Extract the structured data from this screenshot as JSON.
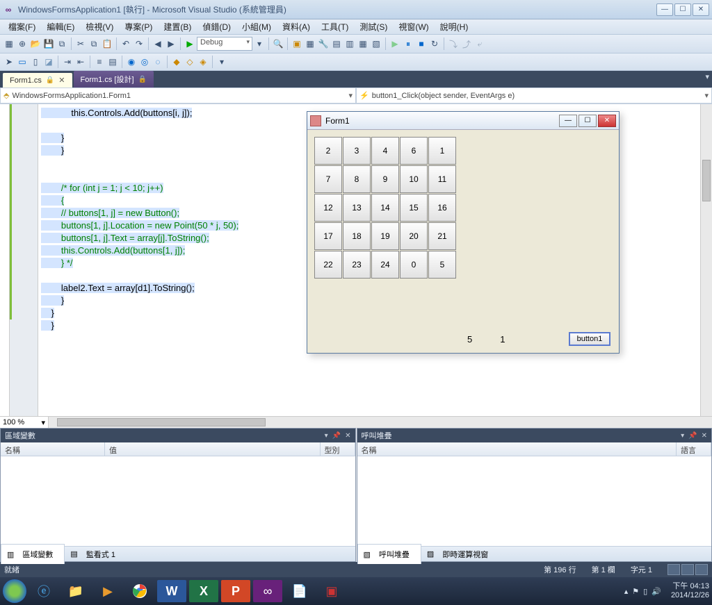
{
  "window": {
    "title": "WindowsFormsApplication1 [執行] - Microsoft Visual Studio (系統管理員)"
  },
  "menu": [
    "檔案(F)",
    "編輯(E)",
    "檢視(V)",
    "專案(P)",
    "建置(B)",
    "偵錯(D)",
    "小組(M)",
    "資料(A)",
    "工具(T)",
    "測試(S)",
    "視窗(W)",
    "說明(H)"
  ],
  "toolbar": {
    "config": "Debug"
  },
  "tabs": [
    {
      "label": "Form1.cs",
      "pinned": true,
      "active": true
    },
    {
      "label": "Form1.cs [設計]",
      "pinned": true,
      "active": false
    }
  ],
  "nav": {
    "left": "WindowsFormsApplication1.Form1",
    "right": "button1_Click(object sender, EventArgs e)"
  },
  "code": {
    "l1": "            this.Controls.Add(buttons[i, j]);",
    "l2": "",
    "l3": "        }",
    "l4": "        }",
    "l5": "",
    "l6": "",
    "l7": "        /* for (int j = 1; j < 10; j++)",
    "l8": "        {",
    "l9": "        // buttons[1, j] = new Button();",
    "l10": "        buttons[1, j].Location = new Point(50 * j, 50);",
    "l11": "        buttons[1, j].Text = array[j].ToString();",
    "l12": "        this.Controls.Add(buttons[1, j]);",
    "l13": "        } */",
    "l14": "",
    "l15": "        label2.Text = array[d1].ToString();",
    "l16": "        }",
    "l17": "    }",
    "l18": "    }",
    "l19": ""
  },
  "zoom": "100 %",
  "runform": {
    "title": "Form1",
    "grid": [
      "2",
      "3",
      "4",
      "6",
      "1",
      "7",
      "8",
      "9",
      "10",
      "11",
      "12",
      "13",
      "14",
      "15",
      "16",
      "17",
      "18",
      "19",
      "20",
      "21",
      "22",
      "23",
      "24",
      "0",
      "5"
    ],
    "label_a": "5",
    "label_b": "1",
    "button": "button1"
  },
  "panels": {
    "left": {
      "title": "區域變數",
      "cols": {
        "name": "名稱",
        "value": "值",
        "type": "型別"
      },
      "tabs": [
        "區域變數",
        "監看式 1"
      ]
    },
    "right": {
      "title": "呼叫堆疊",
      "cols": {
        "name": "名稱",
        "lang": "語言"
      },
      "tabs": [
        "呼叫堆疊",
        "即時運算視窗"
      ]
    }
  },
  "status": {
    "ready": "就緒",
    "line": "第 196 行",
    "col": "第 1 欄",
    "ch": "字元 1"
  },
  "taskbar": {
    "time": "下午 04:13",
    "date": "2014/12/26"
  }
}
